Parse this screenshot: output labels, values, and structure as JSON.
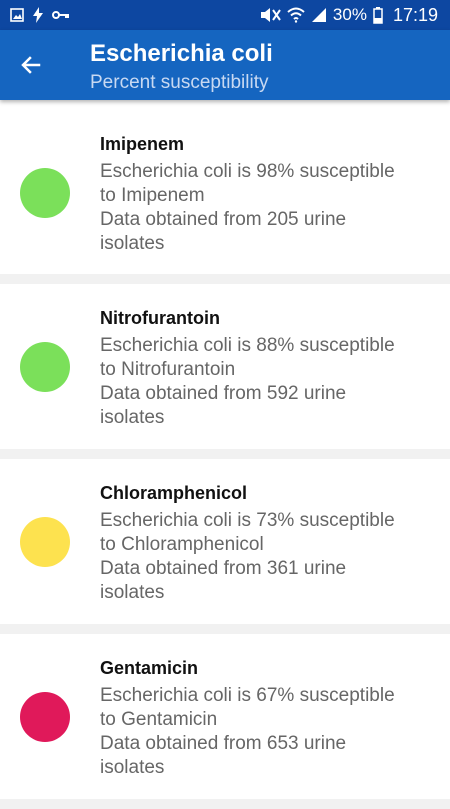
{
  "status_bar": {
    "battery_percent": "30%",
    "time": "17:19",
    "icons": [
      "gallery-icon",
      "flash-icon",
      "key-icon",
      "mute-icon",
      "wifi-icon",
      "signal-icon",
      "battery-icon"
    ]
  },
  "app_bar": {
    "title": "Escherichia coli",
    "subtitle": "Percent susceptibility",
    "back_icon": "arrow-back-icon",
    "background": "#1565c0"
  },
  "items": [
    {
      "name": "Imipenem",
      "line1": "Escherichia coli is 98% susceptible",
      "line2": "to Imipenem",
      "line3": "Data obtained from 205 urine",
      "line4": "isolates",
      "color": "#7be05a"
    },
    {
      "name": "Nitrofurantoin",
      "line1": "Escherichia coli is 88% susceptible",
      "line2": "to Nitrofurantoin",
      "line3": "Data obtained from 592 urine",
      "line4": "isolates",
      "color": "#7be05a"
    },
    {
      "name": "Chloramphenicol",
      "line1": "Escherichia coli is 73% susceptible",
      "line2": "to Chloramphenicol",
      "line3": "Data obtained from 361 urine",
      "line4": "isolates",
      "color": "#fde24f"
    },
    {
      "name": "Gentamicin",
      "line1": "Escherichia coli is 67% susceptible",
      "line2": "to Gentamicin",
      "line3": "Data obtained from 653 urine",
      "line4": "isolates",
      "color": "#e0195a"
    }
  ]
}
